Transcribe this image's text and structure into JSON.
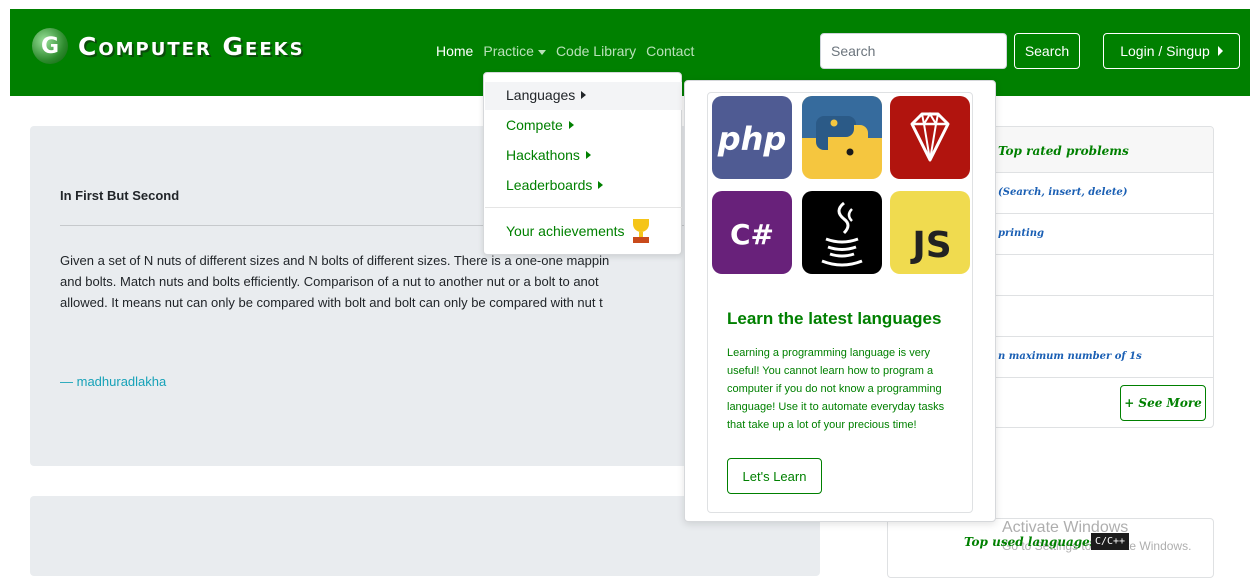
{
  "brand": {
    "logo_letter": "G",
    "name": "Computer Geeks"
  },
  "nav": {
    "home": "Home",
    "practice": "Practice",
    "code_library": "Code Library",
    "contact": "Contact",
    "search_placeholder": "Search",
    "search_button": "Search",
    "login_button": "Login / Singup"
  },
  "practice_menu": {
    "items": [
      {
        "label": "Languages"
      },
      {
        "label": "Compete"
      },
      {
        "label": "Hackathons"
      },
      {
        "label": "Leaderboards"
      }
    ],
    "achievements": "Your achievements"
  },
  "languages_panel": {
    "icons": {
      "php": "php",
      "csharp": "C#",
      "js": "JS"
    },
    "title": "Learn the latest languages",
    "description": "Learning a programming language is very useful! You cannot learn how to program a computer if you do not know a programming language! Use it to automate everyday tasks that take up a lot of your precious time!",
    "button": "Let's Learn"
  },
  "quote": {
    "title": "In First But Second",
    "lines": [
      "Given a set of N nuts of different sizes and N bolts of different sizes. There is a one-one mappin",
      "and bolts. Match nuts and bolts efficiently. Comparison of a nut to another nut or a bolt to anot",
      "allowed. It means nut can only be compared with bolt and bolt can only be compared with nut t"
    ],
    "author": "— madhuradlakha"
  },
  "top_rated": {
    "title": "Top rated problems",
    "items": [
      "(Search, insert, delete)",
      "printing",
      "",
      "",
      "n maximum number of 1s"
    ],
    "see_more": "+ See More"
  },
  "top_languages": {
    "title": "Top used languages",
    "badge": "C/C++"
  },
  "watermark": {
    "line1": "Activate Windows",
    "line2": "Go to Settings to activate Windows."
  }
}
